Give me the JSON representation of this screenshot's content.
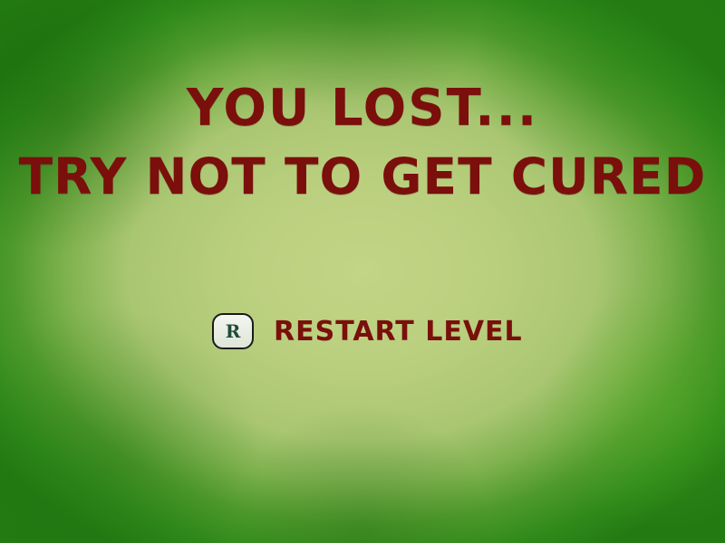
{
  "screen": {
    "title_line_1": "You lost...",
    "title_line_2": "Try not to get cured",
    "restart": {
      "key": "R",
      "label": "Restart level"
    }
  },
  "colors": {
    "title_text": "#7a0f0c",
    "background_center": "#c2d486",
    "background_edge": "#237a12",
    "key_badge_fill": "#eef1ea",
    "key_badge_text": "#1e4a3a"
  }
}
